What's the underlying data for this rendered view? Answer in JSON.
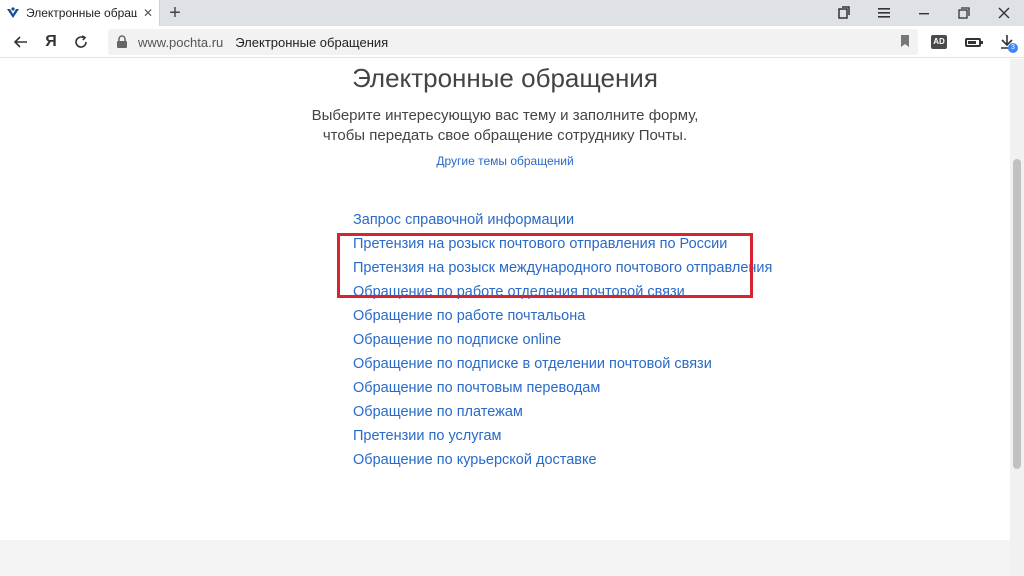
{
  "browser": {
    "tab_title": "Электронные обращен",
    "tab_close": "✕",
    "new_tab": "+",
    "domain": "www.pochta.ru",
    "page_title": "Электронные обращения",
    "ya_label": "Я",
    "download_badge": "3",
    "adblock_label": "AD"
  },
  "page": {
    "heading": "Электронные обращения",
    "subtitle_line1": "Выберите интересующую вас тему и заполните форму,",
    "subtitle_line2": "чтобы передать свое обращение сотруднику Почты.",
    "other_topics": "Другие темы обращений",
    "links": [
      "Запрос справочной информации",
      "Претензия на розыск почтового отправления по России",
      "Претензия на розыск международного почтового отправления",
      "Обращение по работе отделения почтовой связи",
      "Обращение по работе почтальона",
      "Обращение по подписке online",
      "Обращение по подписке в отделении почтовой связи",
      "Обращение по почтовым переводам",
      "Обращение по платежам",
      "Претензии по услугам",
      "Обращение по курьерской доставке"
    ]
  },
  "colors": {
    "link": "#2a6ac8",
    "highlight_border": "#d9232e"
  }
}
